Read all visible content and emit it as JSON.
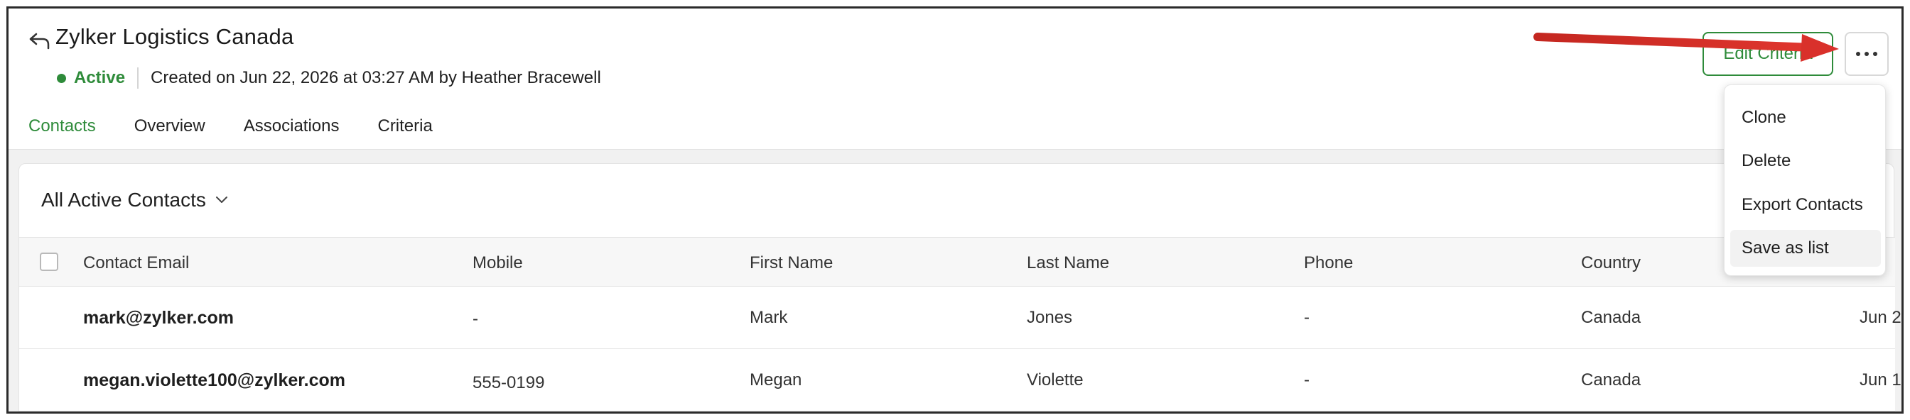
{
  "header": {
    "title": "Zylker Logistics Canada",
    "status": "Active",
    "created_text": "Created on Jun 22, 2026 at 03:27 AM by Heather Bracewell",
    "edit_button_label": "Edit Criteria"
  },
  "tabs": [
    {
      "label": "Contacts",
      "active": true
    },
    {
      "label": "Overview",
      "active": false
    },
    {
      "label": "Associations",
      "active": false
    },
    {
      "label": "Criteria",
      "active": false
    }
  ],
  "view": {
    "selected": "All Active Contacts"
  },
  "table": {
    "columns": [
      "Contact Email",
      "Mobile",
      "First Name",
      "Last Name",
      "Phone",
      "Country"
    ],
    "rows": [
      {
        "email": "mark@zylker.com",
        "mobile": "-",
        "first_name": "Mark",
        "last_name": "Jones",
        "phone": "-",
        "country": "Canada",
        "date": "Jun 2"
      },
      {
        "email": "megan.violette100@zylker.com",
        "mobile": "555-0199",
        "first_name": "Megan",
        "last_name": "Violette",
        "phone": "-",
        "country": "Canada",
        "date": "Jun 1"
      }
    ]
  },
  "more_menu": {
    "items": [
      {
        "label": "Clone"
      },
      {
        "label": "Delete"
      },
      {
        "label": "Export Contacts"
      },
      {
        "label": "Save as list"
      }
    ]
  },
  "colors": {
    "accent": "#2e8b3a",
    "annotation_arrow": "#d9312b"
  },
  "icons": {
    "back": "back-arrow-icon",
    "dropdown": "chevron-down-icon",
    "more": "more-horizontal-icon"
  }
}
